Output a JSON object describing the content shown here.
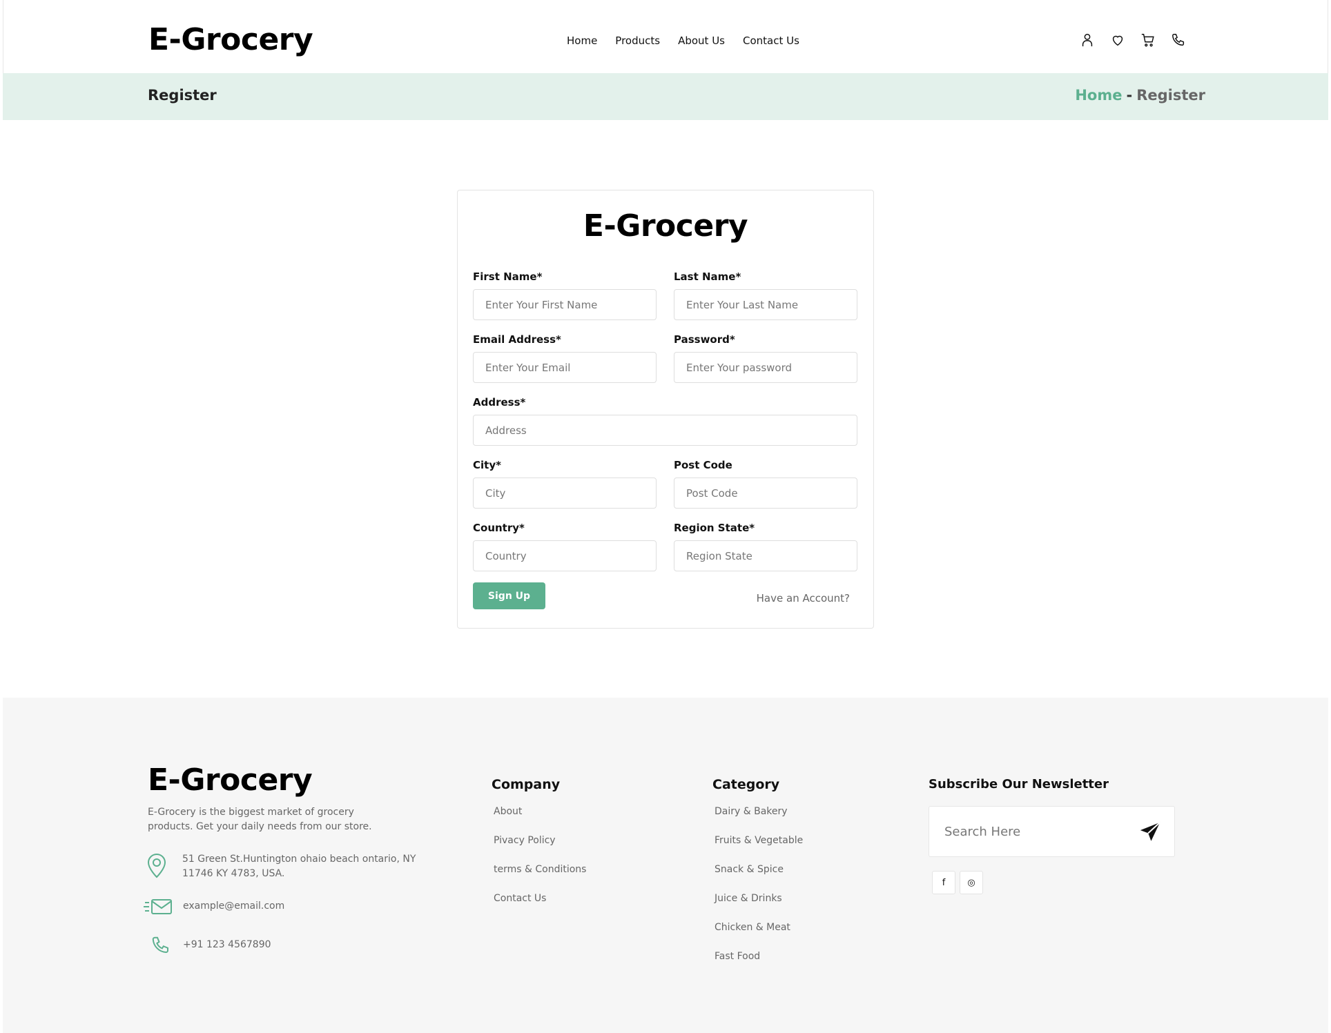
{
  "brand": {
    "name": "E-Grocery"
  },
  "nav": {
    "items": [
      "Home",
      "Products",
      "About Us",
      "Contact Us"
    ]
  },
  "header_icons": [
    "user-icon",
    "heart-icon",
    "cart-icon",
    "phone-icon"
  ],
  "breadcrumb": {
    "title": "Register",
    "home": "Home",
    "separator": "-",
    "current": "Register"
  },
  "form": {
    "first_name": {
      "label": "First Name*",
      "placeholder": "Enter Your First Name"
    },
    "last_name": {
      "label": "Last Name*",
      "placeholder": "Enter Your Last Name"
    },
    "email": {
      "label": "Email Address*",
      "placeholder": "Enter Your Email"
    },
    "password": {
      "label": "Password*",
      "placeholder": "Enter Your password"
    },
    "address": {
      "label": "Address*",
      "placeholder": "Address"
    },
    "city": {
      "label": "City*",
      "placeholder": "City"
    },
    "post_code": {
      "label": "Post Code",
      "placeholder": "Post Code"
    },
    "country": {
      "label": "Country*",
      "placeholder": "Country"
    },
    "region": {
      "label": "Region State*",
      "placeholder": "Region State"
    },
    "submit_label": "Sign Up",
    "have_account": "Have an Account?"
  },
  "footer": {
    "description": "E-Grocery is the biggest market of grocery products. Get your daily needs from our store.",
    "address": "51 Green St.Huntington ohaio beach ontario, NY 11746 KY 4783, USA.",
    "email": "example@email.com",
    "phone": "+91 123 4567890",
    "company": {
      "title": "Company",
      "items": [
        "About",
        "Pivacy Policy",
        "terms & Conditions",
        "Contact Us"
      ]
    },
    "category": {
      "title": "Category",
      "items": [
        "Dairy & Bakery",
        "Fruits & Vegetable",
        "Snack & Spice",
        "Juice & Drinks",
        "Chicken & Meat",
        "Fast Food"
      ]
    },
    "newsletter": {
      "title": "Subscribe Our Newsletter",
      "placeholder": "Search Here"
    },
    "social": [
      "facebook-icon",
      "instagram-icon"
    ],
    "social_glyphs": [
      "f",
      "◎"
    ]
  },
  "colors": {
    "accent": "#5cb08f",
    "breadcrumb_bg": "#e3f1eb",
    "footer_bg": "#f6f6f6"
  }
}
